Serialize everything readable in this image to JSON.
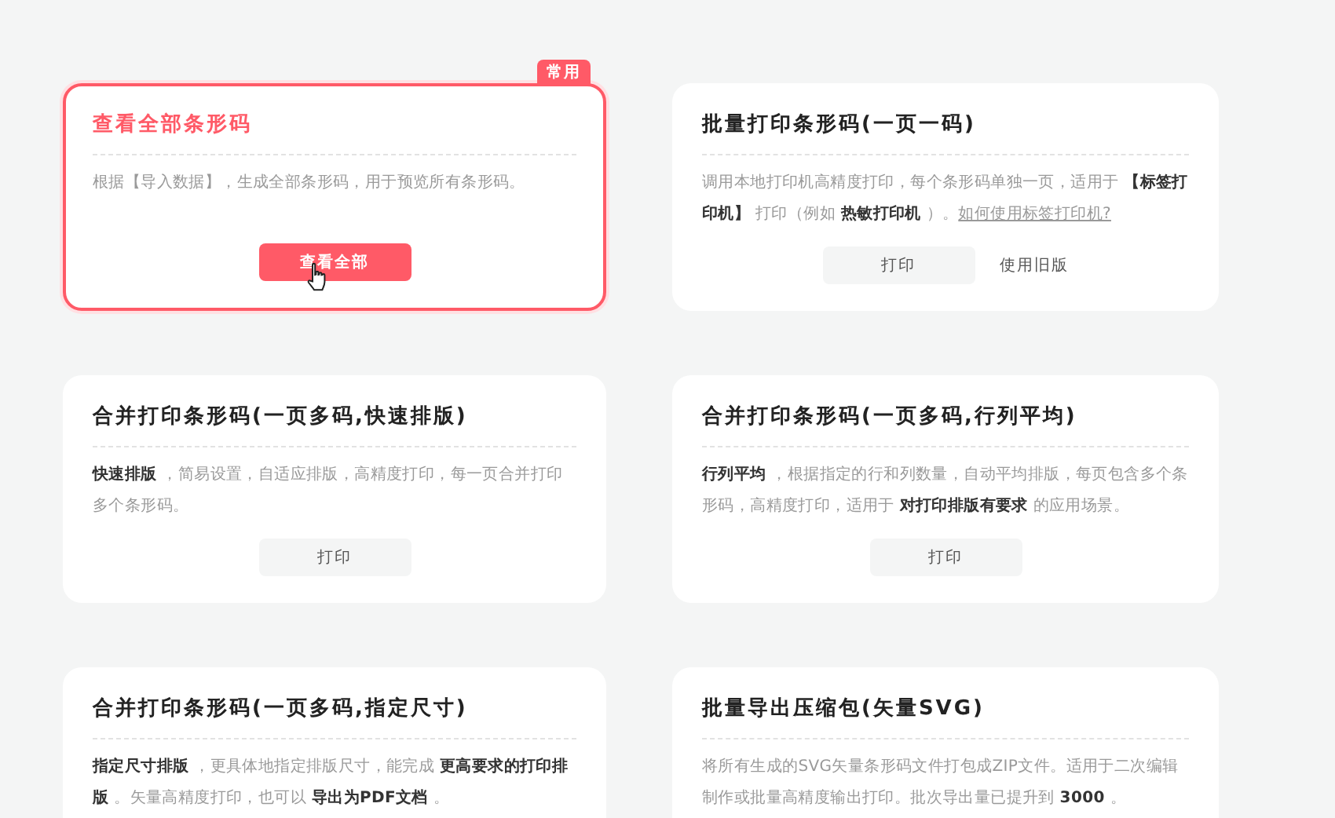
{
  "cards": [
    {
      "title": "查看全部条形码",
      "selected": true,
      "badge": "常用",
      "description": "根据【导入数据】，生成全部条形码，用于预览所有条形码。",
      "buttons": [
        {
          "label": "查看全部",
          "kind": "primary",
          "hovered": true
        }
      ]
    },
    {
      "title": "批量打印条形码(一页一码)",
      "selected": false,
      "description": "调用本地打印机高精度打印，每个条形码单独一页，适用于 **【标签打印机】** 打印（例如 **热敏打印机** ）。",
      "link": "如何使用标签打印机?",
      "buttons": [
        {
          "label": "打印",
          "kind": "secondary",
          "hovered": false
        },
        {
          "label": "使用旧版",
          "kind": "text",
          "hovered": false
        }
      ]
    },
    {
      "title": "合并打印条形码(一页多码,快速排版)",
      "selected": false,
      "description": "**快速排版** ，简易设置，自适应排版，高精度打印，每一页合并打印多个条形码。",
      "buttons": [
        {
          "label": "打印",
          "kind": "secondary",
          "hovered": false
        }
      ]
    },
    {
      "title": "合并打印条形码(一页多码,行列平均)",
      "selected": false,
      "description": "**行列平均** ，根据指定的行和列数量，自动平均排版，每页包含多个条形码，高精度打印，适用于 **对打印排版有要求** 的应用场景。",
      "buttons": [
        {
          "label": "打印",
          "kind": "secondary",
          "hovered": false
        }
      ]
    },
    {
      "title": "合并打印条形码(一页多码,指定尺寸)",
      "selected": false,
      "description": "**指定尺寸排版** ，更具体地指定排版尺寸，能完成 **更高要求的打印排版** 。矢量高精度打印，也可以 **导出为PDF文档** 。"
    },
    {
      "title": "批量导出压缩包(矢量SVG)",
      "selected": false,
      "description": "将所有生成的SVG矢量条形码文件打包成ZIP文件。适用于二次编辑制作或批量高精度输出打印。批次导出量已提升到 **3000** 。"
    }
  ]
}
